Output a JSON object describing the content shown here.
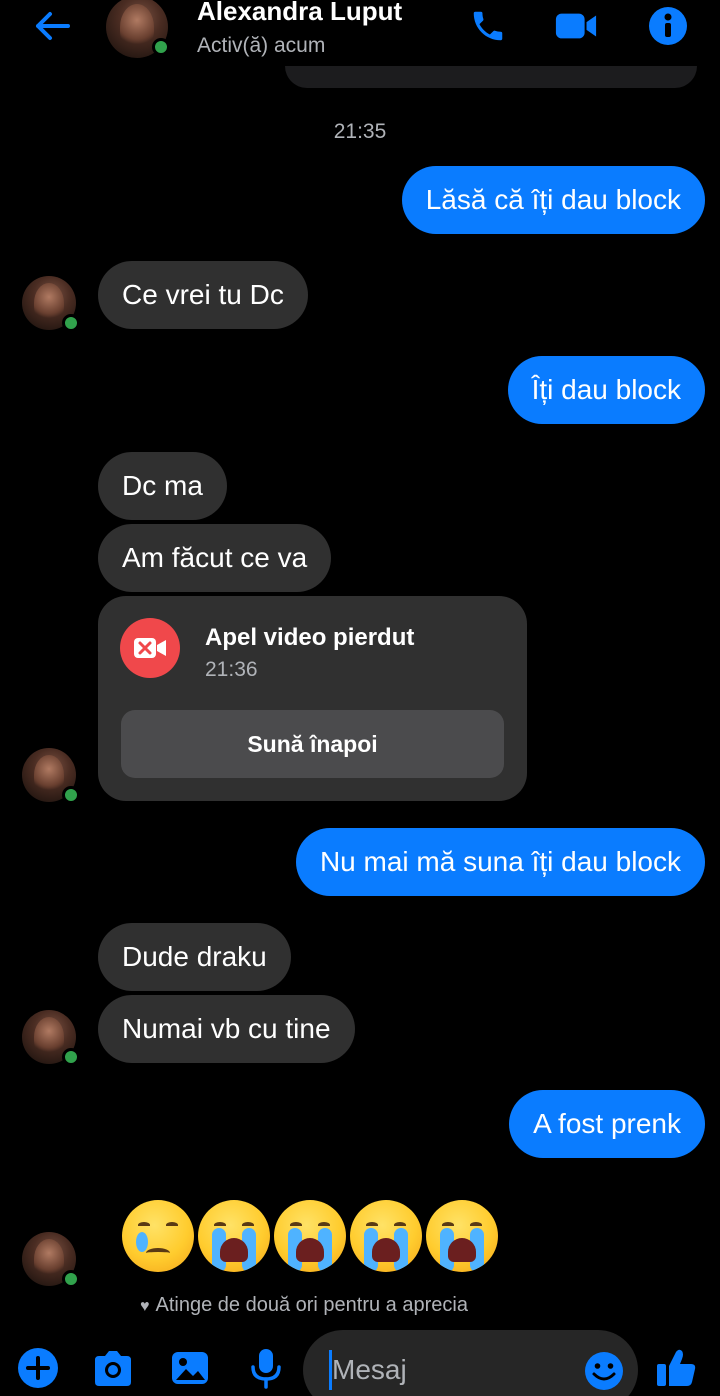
{
  "header": {
    "name": "Alexandra Luput",
    "status": "Activ(ă) acum"
  },
  "timestamp": "21:35",
  "messages": [
    {
      "dir": "out",
      "text": "Lăsă că îți dau block"
    },
    {
      "dir": "in",
      "text": "Ce vrei tu Dc"
    },
    {
      "dir": "out",
      "text": "Îți dau block"
    },
    {
      "dir": "in",
      "text": "Dc ma"
    },
    {
      "dir": "in",
      "text": "Am făcut ce va"
    },
    {
      "dir": "out",
      "text": "Nu mai mă suna îți dau block"
    },
    {
      "dir": "in",
      "text": "Dude draku"
    },
    {
      "dir": "in",
      "text": "Numai vb cu tine"
    },
    {
      "dir": "out",
      "text": "A fost prenk"
    }
  ],
  "call": {
    "title": "Apel video pierdut",
    "time": "21:36",
    "callback_label": "Sună înapoi"
  },
  "emojis": [
    "sad-tear-face",
    "loudly-crying-face",
    "loudly-crying-face",
    "loudly-crying-face",
    "loudly-crying-face"
  ],
  "hint": "Atinge de două ori pentru a aprecia",
  "composer": {
    "placeholder": "Mesaj"
  },
  "colors": {
    "accent": "#0a7cff",
    "incoming_bubble": "#303030",
    "online": "#31a24c",
    "missed_call": "#f0484b"
  }
}
